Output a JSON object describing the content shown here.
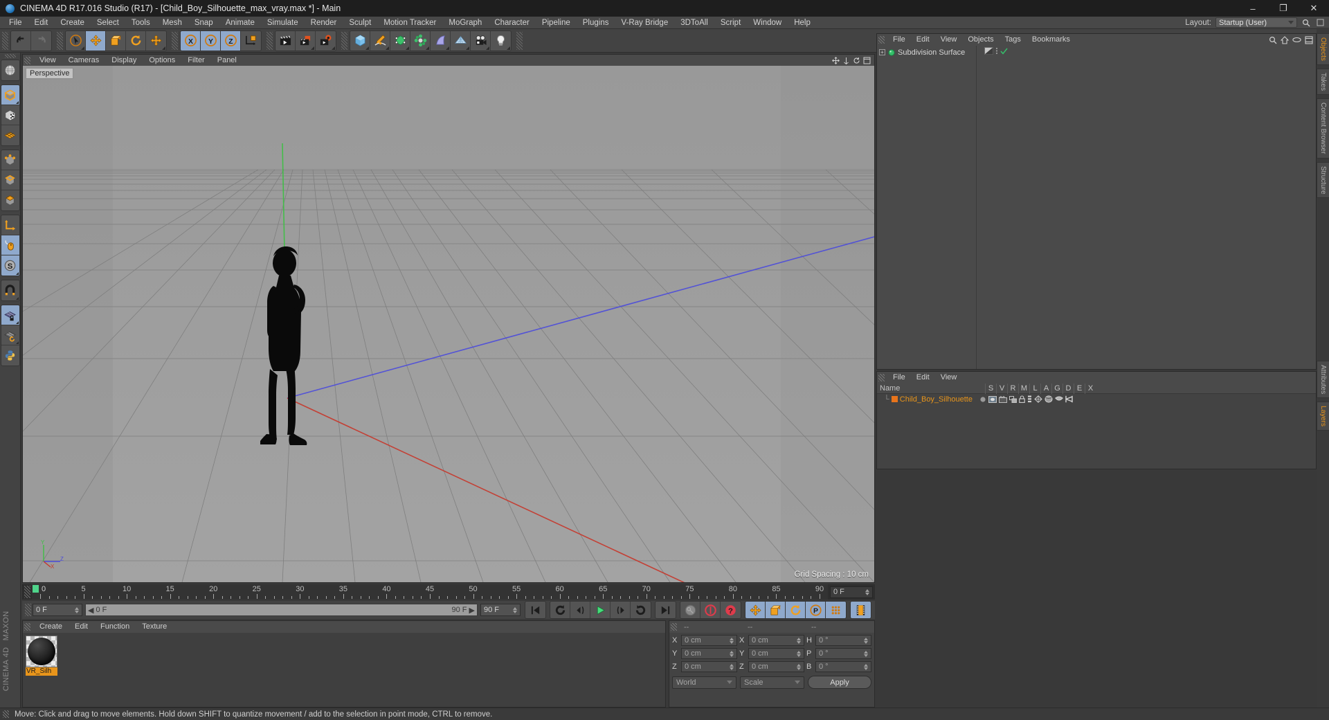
{
  "window": {
    "title": "CINEMA 4D R17.016 Studio (R17) - [Child_Boy_Silhouette_max_vray.max *] - Main",
    "minimize": "–",
    "maximize": "❐",
    "close": "✕"
  },
  "menubar": {
    "items": [
      "File",
      "Edit",
      "Create",
      "Select",
      "Tools",
      "Mesh",
      "Snap",
      "Animate",
      "Simulate",
      "Render",
      "Sculpt",
      "Motion Tracker",
      "MoGraph",
      "Character",
      "Pipeline",
      "Plugins",
      "V-Ray Bridge",
      "3DToAll",
      "Script",
      "Window",
      "Help"
    ],
    "layout_label": "Layout:",
    "layout_value": "Startup (User)",
    "search_icon": "search-icon"
  },
  "toolbar": {
    "groups": [
      {
        "name": "undo-redo",
        "buttons": [
          {
            "name": "undo-button",
            "icon": "undo-arrow-icon",
            "selected": false
          },
          {
            "name": "redo-button",
            "icon": "redo-arrow-icon",
            "selected": false,
            "disabled": true
          }
        ]
      },
      {
        "name": "transform-tools",
        "buttons": [
          {
            "name": "live-selection-tool",
            "icon": "cursor-circle-icon",
            "selected": false,
            "corner": true
          },
          {
            "name": "move-tool",
            "icon": "move-arrows-icon",
            "selected": true
          },
          {
            "name": "scale-tool",
            "icon": "scale-box-icon",
            "selected": false
          },
          {
            "name": "rotate-tool",
            "icon": "rotate-arc-icon",
            "selected": false
          },
          {
            "name": "move-alt-tool",
            "icon": "move-arrows-icon",
            "selected": false,
            "corner": true
          }
        ]
      },
      {
        "name": "axis-locks",
        "buttons": [
          {
            "name": "lock-x-axis-button",
            "icon": "x-axis-icon",
            "label": "X",
            "selected": true
          },
          {
            "name": "lock-y-axis-button",
            "icon": "y-axis-icon",
            "label": "Y",
            "selected": true
          },
          {
            "name": "lock-z-axis-button",
            "icon": "z-axis-icon",
            "label": "Z",
            "selected": true
          },
          {
            "name": "world-object-coordinates-button",
            "icon": "world-axis-cube-icon",
            "selected": false
          }
        ]
      },
      {
        "name": "render-tools",
        "buttons": [
          {
            "name": "render-view-button",
            "icon": "clapperboard-icon",
            "selected": false
          },
          {
            "name": "render-to-picture-viewer-button",
            "icon": "clapperboard-picture-icon",
            "selected": false,
            "corner": true
          },
          {
            "name": "render-settings-button",
            "icon": "clapperboard-gear-icon",
            "selected": false,
            "corner": true
          }
        ]
      },
      {
        "name": "creation-tools",
        "buttons": [
          {
            "name": "add-cube-button",
            "icon": "cube-icon",
            "selected": false,
            "corner": true
          },
          {
            "name": "add-spline-button",
            "icon": "pen-spline-icon",
            "selected": false,
            "corner": true
          },
          {
            "name": "add-generator-button",
            "icon": "nurbs-cube-icon",
            "selected": false,
            "corner": true
          },
          {
            "name": "add-deformer-button",
            "icon": "deformer-icon",
            "selected": false,
            "corner": true
          },
          {
            "name": "add-scene-object-button",
            "icon": "bend-plane-icon",
            "selected": false,
            "corner": true
          },
          {
            "name": "add-floor-button",
            "icon": "grid-floor-icon",
            "selected": false,
            "corner": true
          },
          {
            "name": "add-camera-button",
            "icon": "camera-icon",
            "selected": false,
            "corner": true
          },
          {
            "name": "add-light-button",
            "icon": "lightbulb-icon",
            "selected": false,
            "corner": true
          }
        ]
      }
    ]
  },
  "left_palette": {
    "groups": [
      {
        "name": "undo-view-group",
        "buttons": [
          {
            "name": "undo-view-button",
            "icon": "globe-wire-icon",
            "selected": false
          }
        ]
      },
      {
        "name": "mode-group-1",
        "buttons": [
          {
            "name": "make-editable-button",
            "icon": "editable-cube-icon",
            "selected": true,
            "corner": true
          },
          {
            "name": "model-mode-button",
            "icon": "checker-cube-icon",
            "selected": false
          },
          {
            "name": "texture-mode-button",
            "icon": "texture-grid-icon",
            "selected": false
          }
        ]
      },
      {
        "name": "component-group",
        "buttons": [
          {
            "name": "points-mode-button",
            "icon": "points-cube-icon",
            "selected": false
          },
          {
            "name": "edges-mode-button",
            "icon": "edges-cube-icon",
            "selected": false
          },
          {
            "name": "polygons-mode-button",
            "icon": "polygons-cube-icon",
            "selected": false
          }
        ]
      },
      {
        "name": "axis-group",
        "buttons": [
          {
            "name": "enable-axis-button",
            "icon": "axis-l-icon",
            "selected": false
          },
          {
            "name": "enable-snapping-button",
            "icon": "mouse-icon",
            "selected": true
          },
          {
            "name": "soft-selection-button",
            "icon": "s-circle-icon",
            "selected": true,
            "corner": true
          }
        ]
      },
      {
        "name": "snap-group",
        "buttons": [
          {
            "name": "magnet-button",
            "icon": "magnet-icon",
            "selected": false,
            "corner": true
          }
        ]
      },
      {
        "name": "workplane-group",
        "buttons": [
          {
            "name": "lock-workplane-button",
            "icon": "grid-lock-icon",
            "selected": true,
            "corner": true
          },
          {
            "name": "workplane-rotate-button",
            "icon": "grid-rotate-icon",
            "selected": false,
            "corner": true
          },
          {
            "name": "python-button",
            "icon": "python-icon",
            "selected": false
          }
        ]
      }
    ],
    "brand_line1": "MAXON",
    "brand_line2": "CINEMA 4D"
  },
  "viewport": {
    "menu_items": [
      "View",
      "Cameras",
      "Display",
      "Options",
      "Filter",
      "Panel"
    ],
    "corner_icons": [
      "pan-icon",
      "zoom-icon",
      "rotate-icon",
      "maximize-view-icon"
    ],
    "label": "Perspective",
    "grid_spacing": "Grid Spacing : 10 cm",
    "axis_labels": {
      "y": "Y",
      "x": "X",
      "z": "Z"
    }
  },
  "timeline": {
    "current_frame_field": "0 F",
    "ticks": [
      0,
      5,
      10,
      15,
      20,
      25,
      30,
      35,
      40,
      45,
      50,
      55,
      60,
      65,
      70,
      75,
      80,
      85,
      90
    ],
    "min": 0,
    "max": 90
  },
  "playback": {
    "current_frame": "0 F",
    "range_start": "0 F",
    "range_end": "90 F",
    "end_frame": "90 F",
    "buttons": [
      {
        "name": "go-to-start-button",
        "icon": "skip-start-icon",
        "selected": false
      },
      {
        "name": "play-backwards-loop-button",
        "icon": "loop-ccw-icon",
        "selected": false
      },
      {
        "name": "previous-frame-button",
        "icon": "step-back-icon",
        "selected": false
      },
      {
        "name": "play-button",
        "icon": "play-icon",
        "selected": false
      },
      {
        "name": "next-frame-button",
        "icon": "step-forward-icon",
        "selected": false
      },
      {
        "name": "play-forward-loop-button",
        "icon": "loop-cw-icon",
        "selected": false
      },
      {
        "name": "go-to-end-button",
        "icon": "skip-end-icon",
        "selected": false
      },
      {
        "name": "record-active-objects-button",
        "icon": "key-disabled-icon",
        "selected": false
      },
      {
        "name": "autokeying-button",
        "icon": "autokey-circle-icon",
        "selected": false
      },
      {
        "name": "keyframe-selection-button",
        "icon": "question-circle-icon",
        "selected": false
      },
      {
        "name": "position-key-button",
        "icon": "move-arrows-icon",
        "selected": true
      },
      {
        "name": "scale-key-button",
        "icon": "scale-box-icon",
        "selected": true
      },
      {
        "name": "rotation-key-button",
        "icon": "rotate-arc-icon",
        "selected": true
      },
      {
        "name": "parameter-key-button",
        "icon": "p-circle-icon",
        "selected": true
      },
      {
        "name": "point-level-animation-button",
        "icon": "dots-grid-icon",
        "selected": true
      },
      {
        "name": "timeline-filmstrip-button",
        "icon": "filmstrip-icon",
        "selected": true
      }
    ]
  },
  "material_manager": {
    "menu_items": [
      "Create",
      "Edit",
      "Function",
      "Texture"
    ],
    "materials": [
      {
        "name": "VR_Silhouette",
        "display_name": "VR_Silh",
        "selected": true
      }
    ]
  },
  "coordinates": {
    "headers": [
      "--",
      "--",
      "--"
    ],
    "rows": [
      {
        "pos_axis": "X",
        "pos_value": "0 cm",
        "size_axis": "X",
        "size_value": "0 cm",
        "rot_axis": "H",
        "rot_value": "0 °"
      },
      {
        "pos_axis": "Y",
        "pos_value": "0 cm",
        "size_axis": "Y",
        "size_value": "0 cm",
        "rot_axis": "P",
        "rot_value": "0 °"
      },
      {
        "pos_axis": "Z",
        "pos_value": "0 cm",
        "size_axis": "Z",
        "size_value": "0 cm",
        "rot_axis": "B",
        "rot_value": "0 °"
      }
    ],
    "coord_system": "World",
    "size_mode": "Scale",
    "apply_label": "Apply"
  },
  "object_manager": {
    "menu_items": [
      "File",
      "Edit",
      "View",
      "Objects",
      "Tags",
      "Bookmarks"
    ],
    "header_icons": [
      "search-icon",
      "home-icon",
      "eye-icon",
      "frame-icon"
    ],
    "items": [
      {
        "name": "Subdivision Surface",
        "icon": "subdivision-surface-icon",
        "expandable": true,
        "tags": [
          "material-tag",
          "dots-icon",
          "check-icon"
        ]
      }
    ]
  },
  "list_manager": {
    "menu_items": [
      "File",
      "Edit",
      "View"
    ],
    "columns": [
      "Name",
      "S",
      "V",
      "R",
      "M",
      "L",
      "A",
      "G",
      "D",
      "E",
      "X"
    ],
    "rows": [
      {
        "name": "Child_Boy_Silhouette",
        "color": "#e8741b",
        "icons": [
          "dot-icon",
          "visibility-icon",
          "render-icon",
          "manager-icon",
          "lock-icon",
          "animation-icon",
          "generator-icon",
          "deformer-icon",
          "expression-icon",
          "xref-icon"
        ]
      }
    ]
  },
  "right_tabs": {
    "upper": [
      {
        "label": "Objects",
        "active": true
      },
      {
        "label": "Takes",
        "active": false
      },
      {
        "label": "Content Browser",
        "active": false
      },
      {
        "label": "Structure",
        "active": false
      }
    ],
    "lower": [
      {
        "label": "Attributes",
        "active": false
      },
      {
        "label": "Layers",
        "active": true
      }
    ]
  },
  "statusbar": {
    "message": "Move: Click and drag to move elements. Hold down SHIFT to quantize movement / add to the selection in point mode, CTRL to remove."
  },
  "colors": {
    "accent_orange": "#e8951b",
    "selection_blue": "#8fa9cc",
    "panel_bg": "#434343",
    "viewport_bg": "#9a9a9a",
    "axis_x_red": "#c0392b",
    "axis_y_green": "#2ecc40",
    "axis_z_blue": "#3b4fd8"
  }
}
